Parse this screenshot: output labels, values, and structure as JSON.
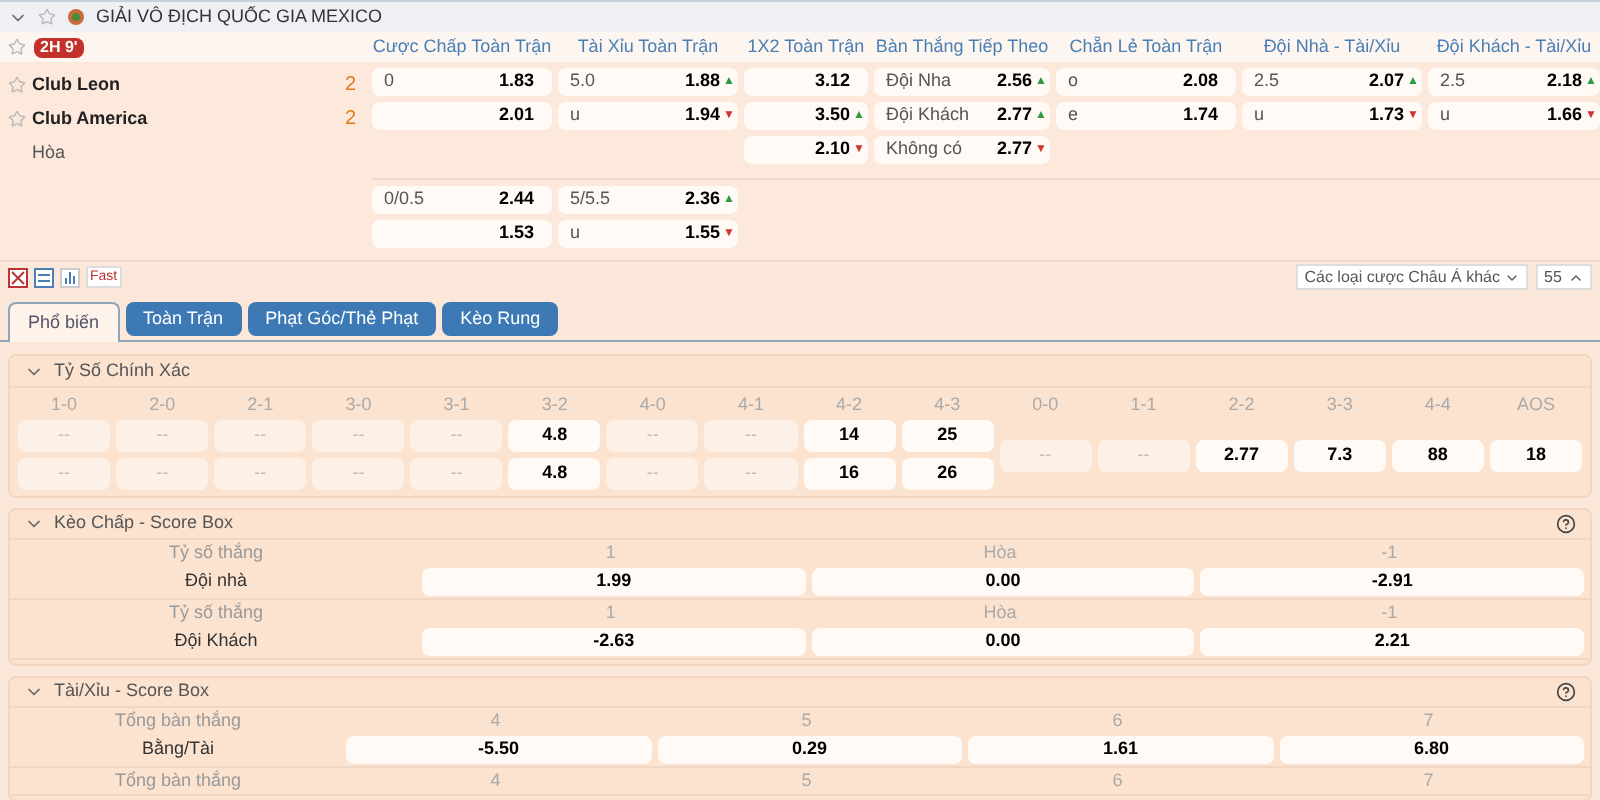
{
  "league": {
    "title": "GIẢI VÔ ĐỊCH QUỐC GIA MEXICO",
    "expanded": true
  },
  "match": {
    "time": "2H 9'",
    "columns": [
      "Cược Chấp Toàn Trận",
      "Tài Xỉu Toàn Trận",
      "1X2 Toàn Trận",
      "Bàn Thắng Tiếp Theo",
      "Chẵn Lẻ Toàn Trận",
      "Đội Nhà - Tài/Xỉu",
      "Đội Khách - Tài/Xỉu"
    ],
    "teams": [
      {
        "name": "Club Leon",
        "score": "2"
      },
      {
        "name": "Club America",
        "score": "2"
      },
      {
        "name": "Hòa"
      }
    ],
    "line_groups": [
      [
        [
          {
            "kind": "odds",
            "label": "0",
            "odds": "1.83"
          },
          {
            "kind": "odds",
            "label": "5.0",
            "odds": "1.88",
            "arrow": "▲",
            "rising": true
          },
          {
            "kind": "odds",
            "odds": "3.12"
          },
          {
            "kind": "odds",
            "label": "Đội Nha",
            "odds": "2.56",
            "arrow": "▲",
            "rising": true
          },
          {
            "kind": "odds",
            "label": "o",
            "odds": "2.08"
          },
          {
            "kind": "odds",
            "label": "2.5",
            "odds": "2.07",
            "arrow": "▲",
            "rising": true
          },
          {
            "kind": "odds",
            "label": "2.5",
            "odds": "2.18",
            "arrow": "▲",
            "rising": true
          }
        ],
        [
          {
            "kind": "odds",
            "odds": "2.01"
          },
          {
            "kind": "odds",
            "label": "u",
            "odds": "1.94",
            "arrow": "▼",
            "rising": false
          },
          {
            "kind": "odds",
            "odds": "3.50",
            "arrow": "▲",
            "rising": true
          },
          {
            "kind": "odds",
            "label": "Đội Khách",
            "odds": "2.77",
            "arrow": "▲",
            "rising": true
          },
          {
            "kind": "odds",
            "label": "e",
            "odds": "1.74"
          },
          {
            "kind": "odds",
            "label": "u",
            "odds": "1.73",
            "arrow": "▼",
            "rising": false
          },
          {
            "kind": "odds",
            "label": "u",
            "odds": "1.66",
            "arrow": "▼",
            "rising": false
          }
        ],
        [
          {
            "kind": "blank"
          },
          {
            "kind": "blank"
          },
          {
            "kind": "odds",
            "odds": "2.10",
            "arrow": "▼",
            "rising": false
          },
          {
            "kind": "odds",
            "label": "Không có",
            "odds": "2.77",
            "arrow": "▼",
            "rising": false
          },
          {
            "kind": "blank"
          },
          {
            "kind": "blank"
          },
          {
            "kind": "blank"
          }
        ]
      ],
      [
        [
          {
            "kind": "odds",
            "label": "0/0.5",
            "odds": "2.44"
          },
          {
            "kind": "odds",
            "label": "5/5.5",
            "odds": "2.36",
            "arrow": "▲",
            "rising": true
          }
        ],
        [
          {
            "kind": "odds",
            "odds": "1.53"
          },
          {
            "kind": "odds",
            "label": "u",
            "odds": "1.55",
            "arrow": "▼",
            "rising": false
          }
        ]
      ]
    ]
  },
  "toolbar": {
    "fast": "Fast",
    "market_select": "Các loại cược Châu Á khác",
    "count": "55"
  },
  "tabs": [
    {
      "label": "Phổ biến",
      "selected": true
    },
    {
      "label": "Toàn Trận",
      "selected": false
    },
    {
      "label": "Phạt Góc/Thẻ Phạt",
      "selected": false
    },
    {
      "label": "Kèo Rung",
      "selected": false
    }
  ],
  "correct_score": {
    "title": "Tỷ Số Chính Xác",
    "expanded": true,
    "scores": [
      {
        "label": "1-0",
        "suspended": true,
        "values": [
          "--",
          "--"
        ]
      },
      {
        "label": "2-0",
        "suspended": true,
        "values": [
          "--",
          "--"
        ]
      },
      {
        "label": "2-1",
        "suspended": true,
        "values": [
          "--",
          "--"
        ]
      },
      {
        "label": "3-0",
        "suspended": true,
        "values": [
          "--",
          "--"
        ]
      },
      {
        "label": "3-1",
        "suspended": true,
        "values": [
          "--",
          "--"
        ]
      },
      {
        "label": "3-2",
        "suspended": false,
        "values": [
          "4.8",
          "4.8"
        ]
      },
      {
        "label": "4-0",
        "suspended": true,
        "values": [
          "--",
          "--"
        ]
      },
      {
        "label": "4-1",
        "suspended": true,
        "values": [
          "--",
          "--"
        ]
      },
      {
        "label": "4-2",
        "suspended": false,
        "values": [
          "14",
          "16"
        ]
      },
      {
        "label": "4-3",
        "suspended": false,
        "values": [
          "25",
          "26"
        ]
      },
      {
        "label": "0-0",
        "suspended": true,
        "values": [
          "--"
        ]
      },
      {
        "label": "1-1",
        "suspended": true,
        "values": [
          "--"
        ]
      },
      {
        "label": "2-2",
        "suspended": false,
        "values": [
          "2.77"
        ]
      },
      {
        "label": "3-3",
        "suspended": false,
        "values": [
          "7.3"
        ]
      },
      {
        "label": "4-4",
        "suspended": false,
        "values": [
          "88"
        ]
      },
      {
        "label": "AOS",
        "suspended": false,
        "values": [
          "18"
        ]
      }
    ]
  },
  "score_boxes": [
    {
      "title": "Kèo Chấp - Score Box",
      "expanded": true,
      "rows": [
        {
          "header_label": "Tỷ số thắng",
          "headers": [
            "1",
            "Hòa",
            "-1"
          ],
          "label": "Đội nhà",
          "values": [
            "1.99",
            "0.00",
            "-2.91"
          ]
        },
        {
          "header_label": "Tỷ số thắng",
          "headers": [
            "1",
            "Hòa",
            "-1"
          ],
          "label": "Đội Khách",
          "values": [
            "-2.63",
            "0.00",
            "2.21"
          ]
        }
      ]
    },
    {
      "title": "Tài/Xỉu - Score Box",
      "expanded": true,
      "rows": [
        {
          "header_label": "Tổng bàn thắng",
          "headers": [
            "4",
            "5",
            "6",
            "7"
          ],
          "label": "Bằng/Tài",
          "values": [
            "-5.50",
            "0.29",
            "1.61",
            "6.80"
          ]
        },
        {
          "header_label": "Tổng bàn thắng",
          "headers": [
            "4",
            "5",
            "6",
            "7"
          ]
        }
      ]
    }
  ]
}
